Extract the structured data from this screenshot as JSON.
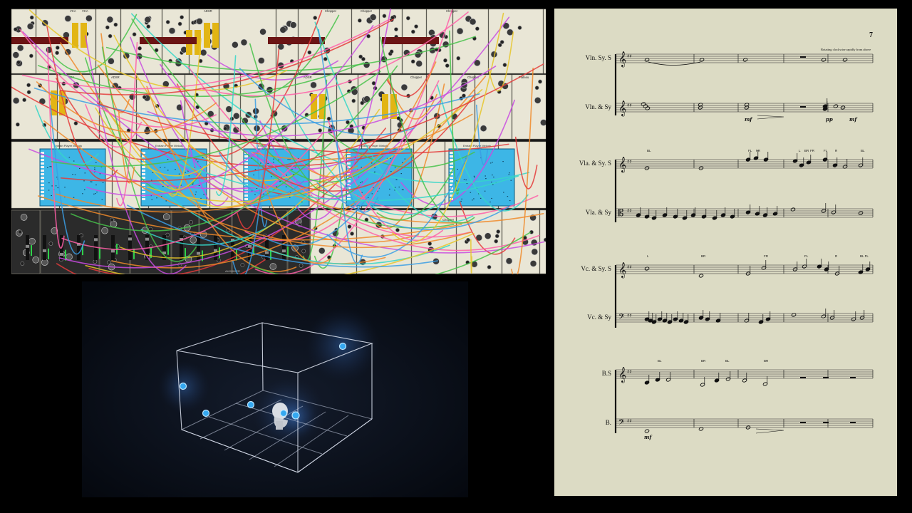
{
  "rack": {
    "module_titles": [
      "VCA",
      "VCA",
      "ADSR",
      "Chopper",
      "Chopper",
      "Chopper",
      "VCA",
      "ADSR",
      "ADSR",
      "Chopper",
      "Plateau",
      "Chopper",
      "Chopper"
    ],
    "player_labels": [
      "Entrain Player Melody",
      "Entrain Player Melody",
      "Entrain Player Melody",
      "Entrain Player Melody",
      "Entrain Player Melody"
    ],
    "mixer_label": "AUXMIXER",
    "plateau_label": "Plateau",
    "valley_label": "Valley",
    "colors": {
      "panel": "#e9e6d6",
      "screen": "#3db6e6",
      "yellow": "#e2b514"
    }
  },
  "score": {
    "page_number": "7",
    "direction_text": "Rotating clockwise rapidly from above",
    "staves": [
      {
        "label": "Vln. Sy. S",
        "clef": "treble"
      },
      {
        "label": "Vln. & Sy",
        "clef": "treble"
      },
      {
        "label": "Vla. & Sy. S",
        "clef": "treble"
      },
      {
        "label": "Vla. & Sy",
        "clef": "alto"
      },
      {
        "label": "Vc. & Sy. S",
        "clef": "treble"
      },
      {
        "label": "Vc. & Sy",
        "clef": "bass"
      },
      {
        "label": "B.S",
        "clef": "treble"
      },
      {
        "label": "B.",
        "clef": "bass"
      }
    ],
    "dynamics": {
      "vln_mf1": "mf",
      "vln_pp": "pp",
      "vln_mf2": "mf",
      "bass_mf": "mf"
    },
    "tech_marks": {
      "vla1": "BL",
      "vla2": "FL",
      "vla3": "FR",
      "vla4": "L",
      "vla5": "BR",
      "vla6": "FR",
      "vla7": "FL",
      "vla8": "R",
      "vla9": "BL",
      "vc1": "L",
      "vc2": "BR",
      "vc3": "FR",
      "vc4": "FL",
      "vc5": "R",
      "vc6": "BL FL",
      "bs1": "BL",
      "bs2": "BR",
      "bs3": "BL",
      "bs4": "BR"
    }
  }
}
